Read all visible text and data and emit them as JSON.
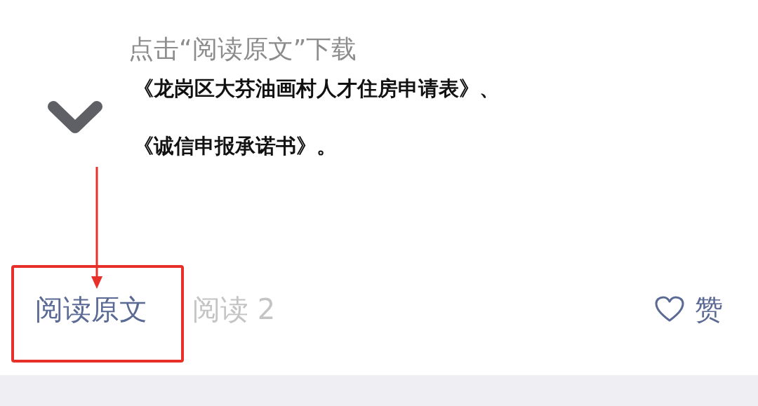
{
  "hint": "点击“阅读原文”下载",
  "lines": [
    "《龙岗区大芬油画村人才住房申请表》、",
    "《诚信申报承诺书》。"
  ],
  "footer": {
    "read_original": "阅读原文",
    "read_count": "阅读 2",
    "like": "赞"
  }
}
